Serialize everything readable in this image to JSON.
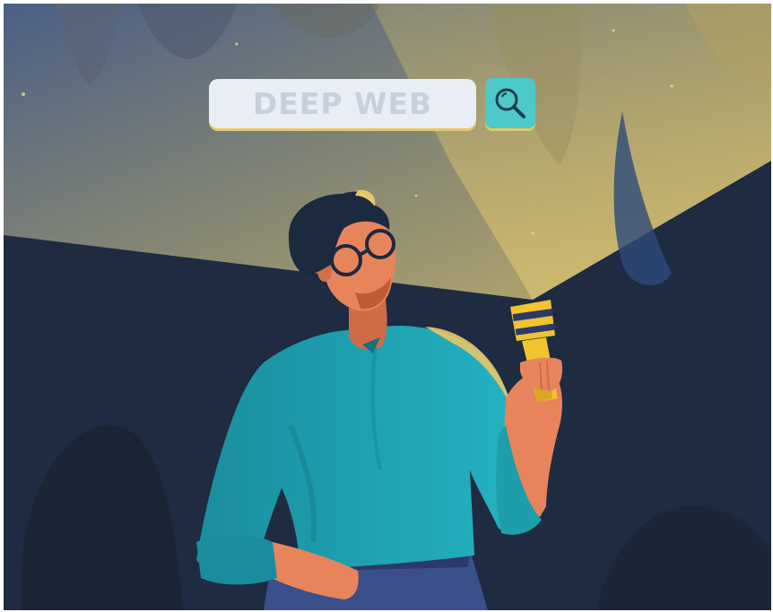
{
  "search": {
    "text": "DEEP WEB",
    "button_icon": "magnifier-icon"
  },
  "colors": {
    "background": "#1e2b40",
    "light_beam": "#b8a968",
    "searchbar": "#e8eef4",
    "search_button": "#4ec9c9",
    "shirt": "#1e9ea8",
    "skin": "#e8845c",
    "flashlight": "#f1c330"
  }
}
